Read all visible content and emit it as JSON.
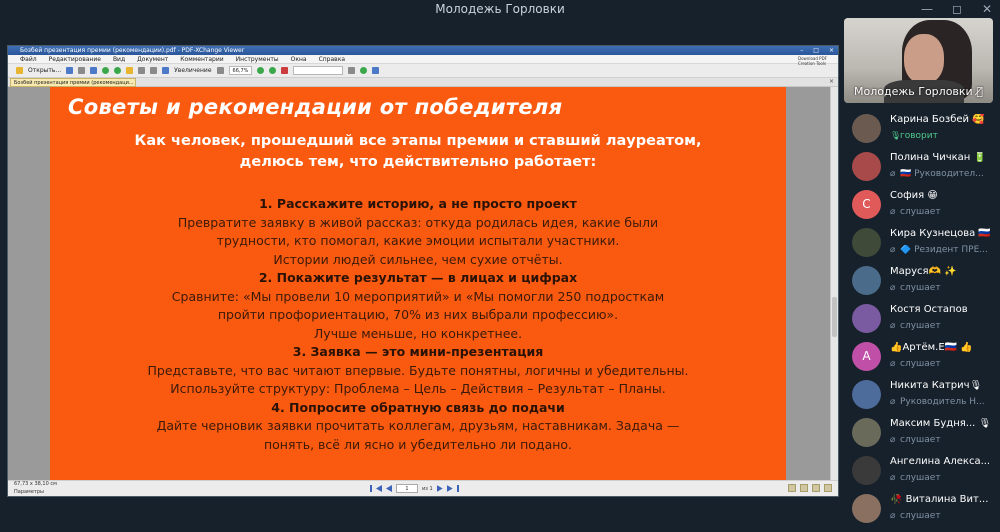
{
  "window": {
    "title": "Молодежь Горловки",
    "minimize": "—",
    "maximize": "◻",
    "close": "✕"
  },
  "pdf": {
    "title": "Бозбей презентация премии (рекомендации).pdf - PDF-XChange Viewer",
    "menu": [
      "Файл",
      "Редактирование",
      "Вид",
      "Документ",
      "Комментарии",
      "Инструменты",
      "Окна",
      "Справка"
    ],
    "brand": "Download PDF Creation Tools",
    "toolbar": {
      "open": "Открыть...",
      "zoom_tool": "Увеличение",
      "zoom_level": "66,7%"
    },
    "tab_label": "Бозбей презентация премии (рекомендаци...",
    "status": {
      "size": "67,73 x 38,10 см",
      "params": "Параметры",
      "page": "1",
      "page_of": "из 1"
    }
  },
  "slide": {
    "title": "Советы и рекомендации от победителя",
    "subtitle": [
      "Как человек, прошедший все этапы премии и ставший лауреатом,",
      "делюсь тем, что действительно работает:"
    ],
    "tips": [
      {
        "heading": "1. Расскажите историю, а не просто проект",
        "lines": [
          "Превратите заявку в живой рассказ: откуда родилась идея, какие были",
          "трудности, кто помогал, какие эмоции испытали участники.",
          "Истории людей сильнее, чем сухие отчёты."
        ]
      },
      {
        "heading": "2. Покажите результат — в лицах и цифрах",
        "lines": [
          "Сравните: «Мы провели 10 мероприятий» и «Мы помогли 250 подросткам",
          "пройти профориентацию, 70% из них выбрали профессию».",
          "Лучше меньше, но конкретнее."
        ]
      },
      {
        "heading": "3. Заявка — это мини-презентация",
        "lines": [
          "Представьте, что вас читают впервые. Будьте понятны, логичны и убедительны.",
          "Используйте структуру: Проблема – Цель – Действия – Результат – Планы."
        ]
      },
      {
        "heading": "4. Попросите обратную связь до подачи",
        "lines": [
          "Дайте черновик заявки прочитать коллегам, друзьям, наставникам. Задача —",
          "понять, всё ли ясно и убедительно ли подано."
        ]
      }
    ]
  },
  "speaker": {
    "name": "Молодежь Горловки",
    "mic_icon": "🎙̸"
  },
  "participants": [
    {
      "name": "Карина Бозбей 🥰",
      "status": "говорит",
      "speaking": true,
      "avatar_text": "",
      "avatar_color": "#6b5a4f"
    },
    {
      "name": "Полина Чичкан 🔋",
      "status": "🇷🇺 Руководител...",
      "speaking": false,
      "avatar_text": "",
      "avatar_color": "#a84a4a"
    },
    {
      "name": "София 😁",
      "status": "слушает",
      "speaking": false,
      "avatar_text": "С",
      "avatar_color": "#e05a5a"
    },
    {
      "name": "Кира Кузнецова 🇷🇺",
      "status": "🔷 Резидент ПРЕ...",
      "speaking": false,
      "avatar_text": "",
      "avatar_color": "#3f4a38"
    },
    {
      "name": "Маруся🫶 ✨",
      "status": "слушает",
      "speaking": false,
      "avatar_text": "",
      "avatar_color": "#4a6b8a"
    },
    {
      "name": "Костя Остапов",
      "status": "слушает",
      "speaking": false,
      "avatar_text": "",
      "avatar_color": "#7a5aa0"
    },
    {
      "name": "👍Артём.Е🇷🇺 👍",
      "status": "слушает",
      "speaking": false,
      "avatar_text": "А",
      "avatar_color": "#c04fa8"
    },
    {
      "name": "Никита Катрич🎙",
      "status": "Руководитель Н...",
      "speaking": false,
      "avatar_text": "",
      "avatar_color": "#4d6b9b"
    },
    {
      "name": "Максим Будня... 🎙",
      "status": "слушает",
      "speaking": false,
      "avatar_text": "",
      "avatar_color": "#6a6a5a"
    },
    {
      "name": "Ангелина Алекса...",
      "status": "слушает",
      "speaking": false,
      "avatar_text": "",
      "avatar_color": "#3a3a3a"
    },
    {
      "name": "🥀 Виталина Вит...",
      "status": "слушает",
      "speaking": false,
      "avatar_text": "",
      "avatar_color": "#8a7060"
    }
  ]
}
